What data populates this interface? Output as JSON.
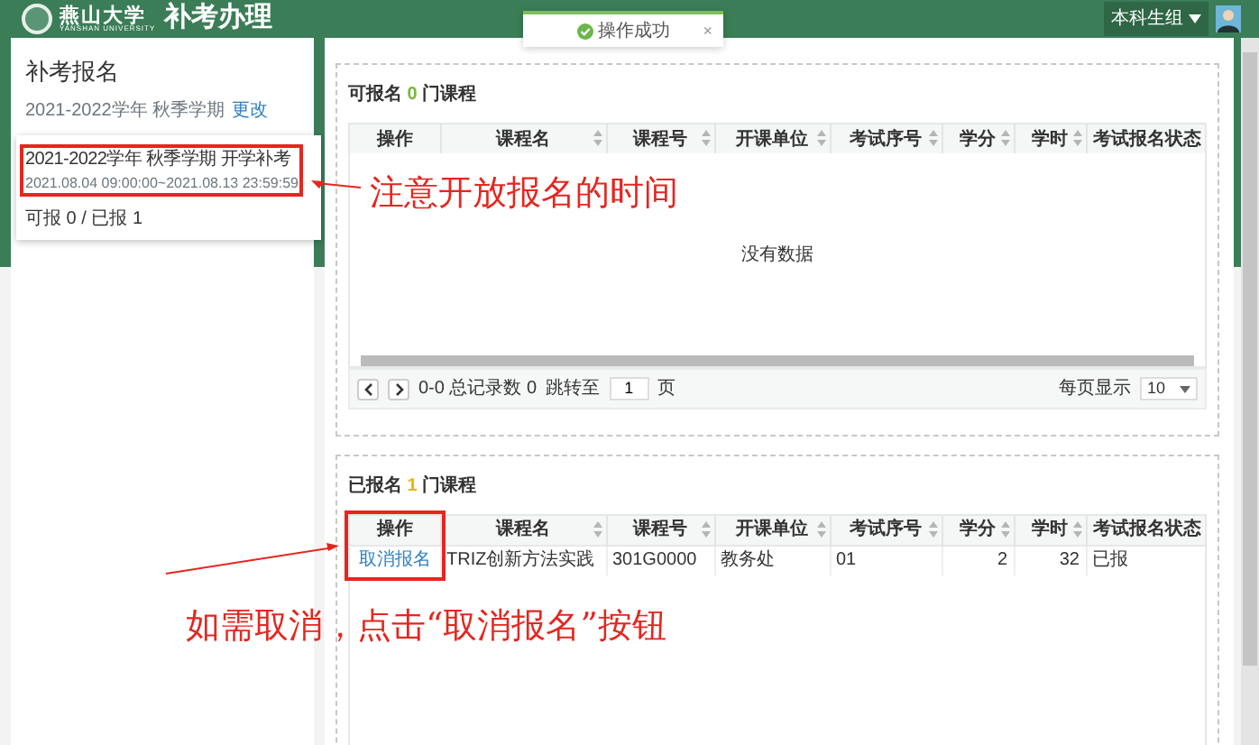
{
  "header": {
    "logo_text": "燕山大学",
    "logo_subtext": "YANSHAN UNIVERSITY",
    "title": "补考办理"
  },
  "toast": {
    "message": "操作成功",
    "close": "×"
  },
  "user_menu": {
    "label": "本科生组"
  },
  "sidebar": {
    "title": "补考报名",
    "term": "2021-2022学年 秋季学期",
    "change_link": "更改",
    "card": {
      "title": "2021-2022学年 秋季学期 开学补考",
      "period": "2021.08.04 09:00:00~2021.08.13 23:59:59",
      "counts": "可报 0 / 已报 1"
    }
  },
  "available": {
    "prefix": "可报名",
    "count": "0",
    "suffix": "门课程",
    "columns": [
      {
        "label": "操作",
        "sortable": false
      },
      {
        "label": "课程名",
        "sortable": true
      },
      {
        "label": "课程号",
        "sortable": true
      },
      {
        "label": "开课单位",
        "sortable": true
      },
      {
        "label": "考试序号",
        "sortable": true
      },
      {
        "label": "学分",
        "sortable": true
      },
      {
        "label": "学时",
        "sortable": true
      },
      {
        "label": "考试报名状态",
        "sortable": false
      }
    ],
    "empty_text": "没有数据",
    "pager": {
      "range": "0-0 总记录数 0",
      "jump_label": "跳转至",
      "page": "1",
      "page_unit": "页",
      "per_page_label": "每页显示",
      "per_page": "10"
    }
  },
  "registered": {
    "prefix": "已报名",
    "count": "1",
    "suffix": "门课程",
    "columns": [
      {
        "label": "操作",
        "kind": "action",
        "sortable": false
      },
      {
        "label": "课程名",
        "kind": "text",
        "sortable": true
      },
      {
        "label": "课程号",
        "kind": "text",
        "sortable": true
      },
      {
        "label": "开课单位",
        "kind": "text",
        "sortable": true
      },
      {
        "label": "考试序号",
        "kind": "text",
        "sortable": true
      },
      {
        "label": "学分",
        "kind": "number",
        "sortable": true
      },
      {
        "label": "学时",
        "kind": "number",
        "sortable": true
      },
      {
        "label": "考试报名状态",
        "kind": "text",
        "sortable": false
      }
    ],
    "rows": [
      {
        "cells": [
          "取消报名",
          "TRIZ创新方法实践",
          "301G0000",
          "教务处",
          "01",
          "2",
          "32",
          "已报"
        ]
      }
    ]
  },
  "annotations": [
    {
      "text": "注意开放报名的时间"
    },
    {
      "text": "如需取消，点击“取消报名”按钮"
    }
  ]
}
